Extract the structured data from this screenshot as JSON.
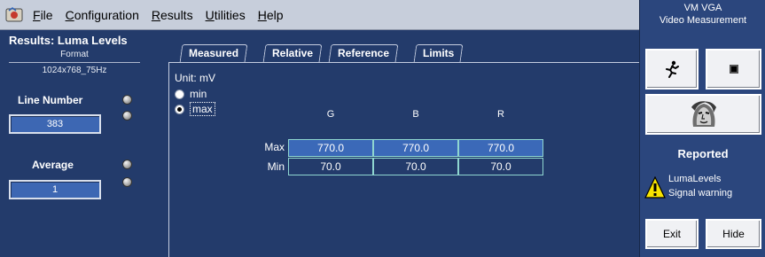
{
  "menubar": {
    "items": [
      {
        "label": "File",
        "accel": "F",
        "rest": "ile"
      },
      {
        "label": "Configuration",
        "accel": "C",
        "rest": "onfiguration"
      },
      {
        "label": "Results",
        "accel": "R",
        "rest": "esults"
      },
      {
        "label": "Utilities",
        "accel": "U",
        "rest": "tilities"
      },
      {
        "label": "Help",
        "accel": "H",
        "rest": "elp"
      }
    ]
  },
  "left_panel": {
    "title": "Results: Luma Levels",
    "format_label": "Format",
    "format_value": "1024x768_75Hz",
    "line_number_label": "Line Number",
    "line_number_value": "383",
    "average_label": "Average",
    "average_value": "1"
  },
  "tabs": [
    {
      "label": "Measured"
    },
    {
      "label": "Relative"
    },
    {
      "label": "Reference"
    },
    {
      "label": "Limits",
      "active": true
    }
  ],
  "limits": {
    "unit": "Unit: mV",
    "radio_min": "min",
    "radio_max": "max",
    "selected": "max",
    "columns": [
      "G",
      "B",
      "R"
    ],
    "rows": [
      {
        "label": "Max",
        "values": [
          "770.0",
          "770.0",
          "770.0"
        ]
      },
      {
        "label": "Min",
        "values": [
          "70.0",
          "70.0",
          "70.0"
        ]
      }
    ]
  },
  "right_panel": {
    "title_line1": "VM VGA",
    "title_line2": "Video Measurement",
    "reported_label": "Reported",
    "warning_line1": "LumaLevels",
    "warning_line2": "Signal warning",
    "exit_label": "Exit",
    "hide_label": "Hide",
    "icons": {
      "run": "running-man-icon",
      "stop": "stop-icon",
      "image": "face-image-icon",
      "warning": "warning-icon"
    }
  }
}
